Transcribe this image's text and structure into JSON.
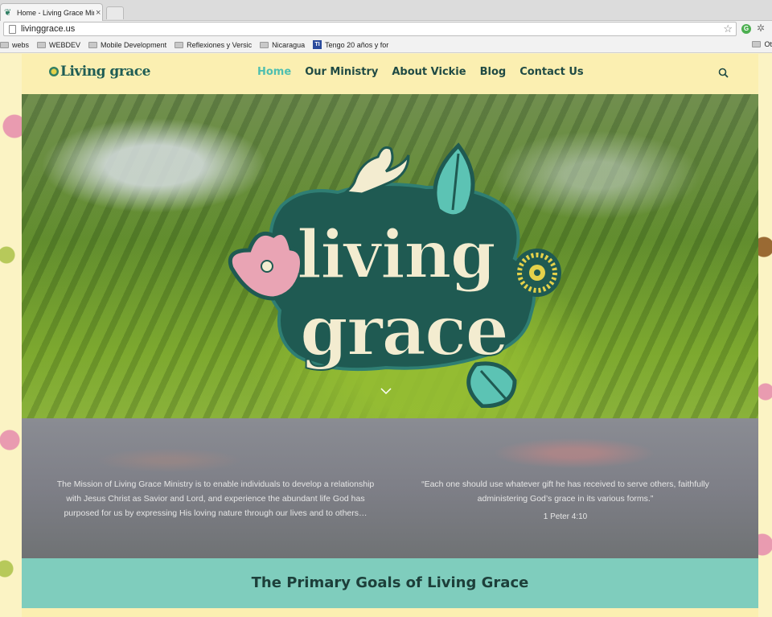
{
  "browser": {
    "tab_title": "Home - Living Grace Minis",
    "tab_close": "×",
    "url": "livinggrace.us",
    "star": "☆",
    "ext_icon_1": "G",
    "bookmarks": [
      {
        "label": "webs",
        "icon": "folder-icon"
      },
      {
        "label": "WEBDEV",
        "icon": "folder-icon"
      },
      {
        "label": "Mobile Development",
        "icon": "folder-icon"
      },
      {
        "label": "Reflexiones y Versic",
        "icon": "folder-icon"
      },
      {
        "label": "Nicaragua",
        "icon": "folder-icon"
      },
      {
        "label": "Tengo 20 años y for",
        "icon": "ti-icon"
      }
    ],
    "bookmarks_overflow": "Ot",
    "ti_label": "TI"
  },
  "site": {
    "logo_text": "Living grace",
    "nav": [
      {
        "label": "Home",
        "active": true
      },
      {
        "label": "Our Ministry",
        "active": false
      },
      {
        "label": "About Vickie",
        "active": false
      },
      {
        "label": "Blog",
        "active": false
      },
      {
        "label": "Contact Us",
        "active": false
      }
    ],
    "hero_logo_lines": [
      "living",
      "grace"
    ],
    "mission": "The Mission of Living Grace Ministry is to enable individuals to develop a relationship with Jesus Christ as Savior and Lord, and experience the abundant life God has purposed for us by expressing His loving nature through our lives and to others…",
    "verse": "“Each one should use whatever gift he has received to serve others, faithfully administering God’s grace in its various forms.”",
    "verse_ref": "1 Peter 4:10",
    "goals_title": "The Primary Goals of Living Grace"
  },
  "colors": {
    "nav_text": "#1f4a44",
    "nav_active": "#4fbfb0",
    "header_bg": "#fbefb1",
    "goals_band": "#7fcdbd",
    "logo_dark": "#1f5a52",
    "logo_cream": "#f3ecd0"
  }
}
